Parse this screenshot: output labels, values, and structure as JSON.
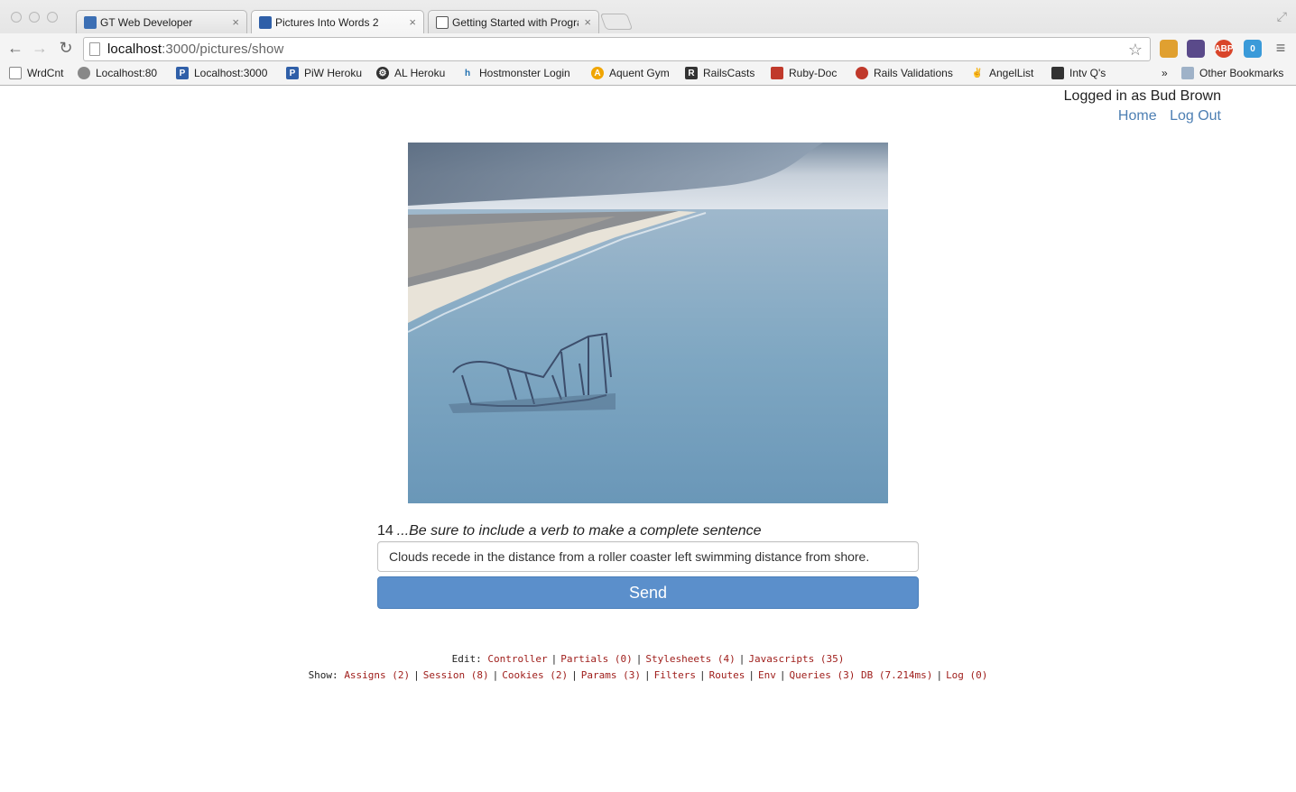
{
  "browser": {
    "tabs": [
      {
        "label": "GT Web Developer",
        "favicon_color": "#3c6fb4",
        "active": false
      },
      {
        "label": "Pictures Into Words 2",
        "favicon_color": "#2f5fa8",
        "active": true
      },
      {
        "label": "Getting Started with Progra",
        "favicon_color": "#2b7a3a",
        "active": false
      }
    ],
    "close_glyph": "×",
    "url_host": "localhost",
    "url_path": ":3000/pictures/show",
    "bookmarks": [
      {
        "label": "WrdCnt",
        "icon": "page-icon",
        "color": "#ffffff"
      },
      {
        "label": "Localhost:80",
        "icon": "globe-icon",
        "color": "#888888"
      },
      {
        "label": "Localhost:3000",
        "icon": "p-logo-icon",
        "color": "#2f5fa8"
      },
      {
        "label": "PiW Heroku",
        "icon": "p-logo-icon",
        "color": "#2f5fa8"
      },
      {
        "label": "AL Heroku",
        "icon": "gear-icon",
        "color": "#333333"
      },
      {
        "label": "Hostmonster Login",
        "icon": "hm-logo-icon",
        "color": "#1f6fb0"
      },
      {
        "label": "Aquent Gym",
        "icon": "aquent-icon",
        "color": "#f0a500"
      },
      {
        "label": "RailsCasts",
        "icon": "railscasts-icon",
        "color": "#333333"
      },
      {
        "label": "Ruby-Doc",
        "icon": "ruby-icon",
        "color": "#c0392b"
      },
      {
        "label": "Rails Validations",
        "icon": "rails-icon",
        "color": "#c0392b"
      },
      {
        "label": "AngelList",
        "icon": "peace-hand-icon",
        "color": "#333333"
      },
      {
        "label": "Intv Q's",
        "icon": "image-icon",
        "color": "#333333"
      }
    ],
    "overflow": "»",
    "other_bookmarks": "Other Bookmarks",
    "extensions": [
      {
        "name": "ext-bookmark-icon",
        "text": "",
        "color": "#e0a030"
      },
      {
        "name": "ext-mask-icon",
        "text": "",
        "color": "#5a4a8a"
      },
      {
        "name": "adblock-icon",
        "text": "ABP",
        "color": "#d9452a"
      },
      {
        "name": "ghostery-icon",
        "text": "0",
        "color": "#3a9ad9"
      }
    ]
  },
  "account": {
    "logged_in": "Logged in as Bud Brown",
    "home": "Home",
    "logout": "Log Out"
  },
  "exercise": {
    "number": "14",
    "hint": "...Be sure to include a verb to make a complete sentence",
    "answer": "Clouds recede in the distance from a roller coaster left swimming distance from shore.",
    "send": "Send"
  },
  "debug": {
    "edit_label": "Edit:",
    "edit_links": [
      "Controller",
      "Partials (0)",
      "Stylesheets (4)",
      "Javascripts (35)"
    ],
    "show_label": "Show:",
    "show_links": [
      "Assigns (2)",
      "Session (8)",
      "Cookies (2)",
      "Params (3)",
      "Filters",
      "Routes",
      "Env",
      "Queries (3) DB (7.214ms)",
      "Log (0)"
    ]
  }
}
